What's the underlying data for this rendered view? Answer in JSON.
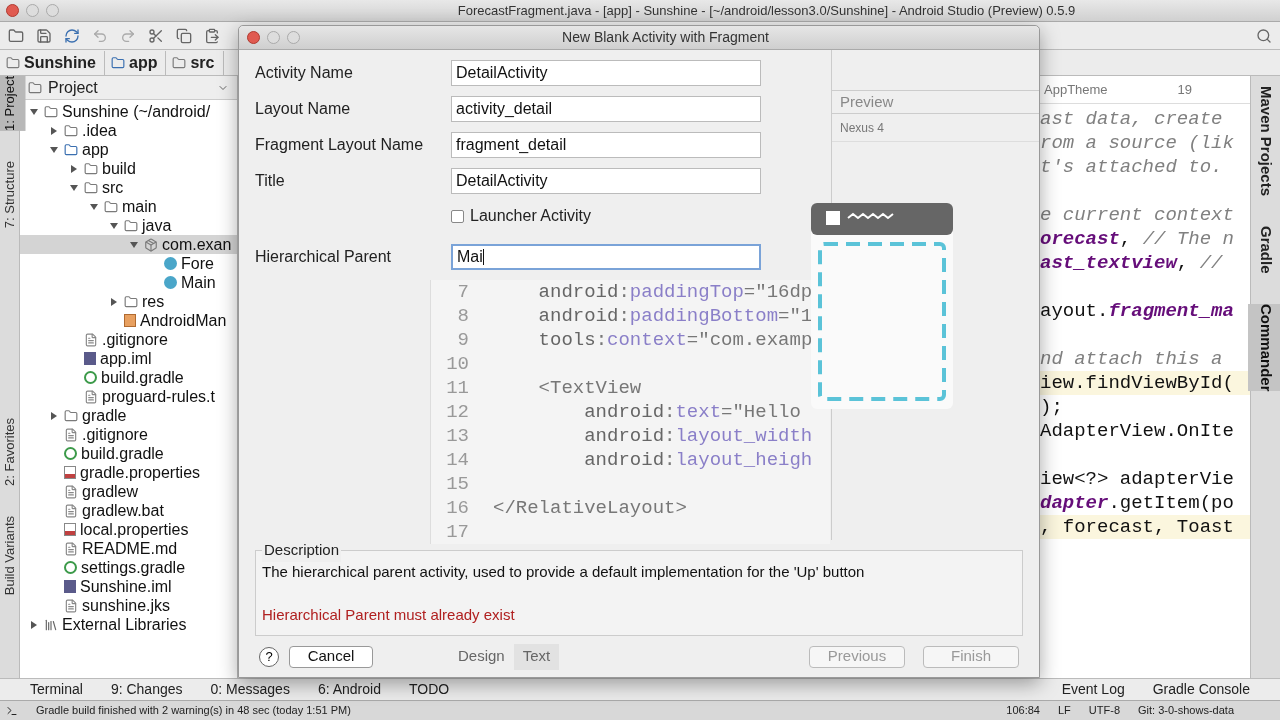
{
  "window": {
    "title": "ForecastFragment.java - [app] - Sunshine - [~/android/lesson3.0/Sunshine] - Android Studio (Preview) 0.5.9"
  },
  "breadcrumb": [
    {
      "label": "Sunshine",
      "kind": "project"
    },
    {
      "label": "app",
      "kind": "module"
    },
    {
      "label": "src",
      "kind": "folder"
    }
  ],
  "left_tool_tabs": [
    {
      "label": "1: Project",
      "selected": true
    },
    {
      "label": "7: Structure",
      "selected": false
    },
    {
      "label": "2: Favorites",
      "selected": false
    },
    {
      "label": "Build Variants",
      "selected": false
    }
  ],
  "project_panel": {
    "title": "Project",
    "tree": [
      {
        "label": "Sunshine (~/android/",
        "kind": "folder",
        "expanded": true,
        "selected": false,
        "children": [
          {
            "label": ".idea",
            "kind": "folder",
            "expanded": false,
            "selected": false
          },
          {
            "label": "app",
            "kind": "module",
            "expanded": true,
            "selected": false,
            "children": [
              {
                "label": "build",
                "kind": "folder",
                "expanded": false,
                "selected": false
              },
              {
                "label": "src",
                "kind": "folder",
                "expanded": true,
                "selected": false,
                "children": [
                  {
                    "label": "main",
                    "kind": "folder",
                    "expanded": true,
                    "selected": false,
                    "children": [
                      {
                        "label": "java",
                        "kind": "folder",
                        "expanded": true,
                        "selected": false,
                        "children": [
                          {
                            "label": "com.exan",
                            "kind": "package",
                            "expanded": true,
                            "selected": true,
                            "children": [
                              {
                                "label": "Fore",
                                "kind": "class",
                                "selected": false
                              },
                              {
                                "label": "Main",
                                "kind": "class",
                                "selected": false
                              }
                            ]
                          }
                        ]
                      },
                      {
                        "label": "res",
                        "kind": "folder",
                        "expanded": false,
                        "selected": false
                      },
                      {
                        "label": "AndroidMan",
                        "kind": "xml",
                        "selected": false
                      }
                    ]
                  }
                ]
              },
              {
                "label": ".gitignore",
                "kind": "file",
                "selected": false
              },
              {
                "label": "app.iml",
                "kind": "iml",
                "selected": false
              },
              {
                "label": "build.gradle",
                "kind": "gradle",
                "selected": false
              },
              {
                "label": "proguard-rules.t",
                "kind": "file",
                "selected": false
              }
            ]
          },
          {
            "label": "gradle",
            "kind": "folder",
            "expanded": false,
            "selected": false
          },
          {
            "label": ".gitignore",
            "kind": "file",
            "selected": false
          },
          {
            "label": "build.gradle",
            "kind": "gradle",
            "selected": false
          },
          {
            "label": "gradle.properties",
            "kind": "props",
            "selected": false
          },
          {
            "label": "gradlew",
            "kind": "file",
            "selected": false
          },
          {
            "label": "gradlew.bat",
            "kind": "file",
            "selected": false
          },
          {
            "label": "local.properties",
            "kind": "props",
            "selected": false
          },
          {
            "label": "README.md",
            "kind": "file",
            "selected": false
          },
          {
            "label": "settings.gradle",
            "kind": "gradle",
            "selected": false
          },
          {
            "label": "Sunshine.iml",
            "kind": "iml",
            "selected": false
          },
          {
            "label": "sunshine.jks",
            "kind": "file",
            "selected": false
          }
        ]
      },
      {
        "label": "External Libraries",
        "kind": "library",
        "expanded": false,
        "selected": false
      }
    ]
  },
  "dialog": {
    "title": "New Blank Activity with Fragment",
    "fields": [
      {
        "kind": "text",
        "label": "Activity Name",
        "value": "DetailActivity",
        "focused": false
      },
      {
        "kind": "text",
        "label": "Layout Name",
        "value": "activity_detail",
        "focused": false
      },
      {
        "kind": "text",
        "label": "Fragment Layout Name",
        "value": "fragment_detail",
        "focused": false
      },
      {
        "kind": "text",
        "label": "Title",
        "value": "DetailActivity",
        "focused": false
      },
      {
        "kind": "checkbox",
        "label": "Launcher Activity",
        "checked": false
      },
      {
        "kind": "text",
        "label": "Hierarchical Parent",
        "value": "Mai",
        "focused": true
      }
    ],
    "code_lines": [
      {
        "n": "7",
        "tokens": [
          {
            "text": "    android",
            "kind": "ns"
          },
          {
            "text": ":",
            "kind": "plain"
          },
          {
            "text": "paddingTop",
            "kind": "attr"
          },
          {
            "text": "=\"16dp",
            "kind": "val"
          }
        ]
      },
      {
        "n": "8",
        "tokens": [
          {
            "text": "    android",
            "kind": "ns"
          },
          {
            "text": ":",
            "kind": "plain"
          },
          {
            "text": "paddingBottom",
            "kind": "attr"
          },
          {
            "text": "=\"1",
            "kind": "val"
          }
        ]
      },
      {
        "n": "9",
        "tokens": [
          {
            "text": "    tools",
            "kind": "ns"
          },
          {
            "text": ":",
            "kind": "plain"
          },
          {
            "text": "context",
            "kind": "attr"
          },
          {
            "text": "=\"com.examp",
            "kind": "val"
          }
        ]
      },
      {
        "n": "10"
      },
      {
        "n": "11",
        "tokens": [
          {
            "text": "    <TextView",
            "kind": "tag"
          }
        ]
      },
      {
        "n": "12",
        "tokens": [
          {
            "text": "        android",
            "kind": "ns"
          },
          {
            "text": ":",
            "kind": "plain"
          },
          {
            "text": "text",
            "kind": "attr"
          },
          {
            "text": "=\"Hello",
            "kind": "val"
          }
        ]
      },
      {
        "n": "13",
        "tokens": [
          {
            "text": "        android",
            "kind": "ns"
          },
          {
            "text": ":",
            "kind": "plain"
          },
          {
            "text": "layout_width",
            "kind": "attr"
          }
        ]
      },
      {
        "n": "14",
        "tokens": [
          {
            "text": "        android",
            "kind": "ns"
          },
          {
            "text": ":",
            "kind": "plain"
          },
          {
            "text": "layout_heigh",
            "kind": "attr"
          }
        ]
      },
      {
        "n": "15"
      },
      {
        "n": "16",
        "tokens": [
          {
            "text": "</RelativeLayout>",
            "kind": "tag"
          }
        ]
      },
      {
        "n": "17"
      }
    ],
    "preview": {
      "title": "Preview",
      "device": "Nexus 4"
    },
    "description": {
      "title": "Description",
      "text": "The hierarchical parent activity, used to provide a default implementation for the 'Up' button",
      "error": "Hierarchical Parent must already exist"
    },
    "help": "?",
    "editor_tabs": [
      {
        "label": "Design",
        "selected": false
      },
      {
        "label": "Text",
        "selected": true
      }
    ],
    "buttons": [
      {
        "label": "Cancel",
        "enabled": true
      },
      {
        "label": "Previous",
        "enabled": false
      },
      {
        "label": "Finish",
        "enabled": false
      }
    ]
  },
  "editor_toolbar": {
    "theme": "AppTheme",
    "api": "19"
  },
  "editor_blocks": [
    [
      {
        "highlighted": false,
        "tokens": [
          {
            "text": "ast data, create",
            "kind": "comment"
          }
        ]
      },
      {
        "highlighted": false,
        "tokens": [
          {
            "text": "rom a source (lik",
            "kind": "comment"
          }
        ]
      },
      {
        "highlighted": false,
        "tokens": [
          {
            "text": "t's attached to.",
            "kind": "comment"
          }
        ]
      }
    ],
    [
      {
        "highlighted": false,
        "tokens": [
          {
            "text": "e current context",
            "kind": "comment"
          }
        ]
      },
      {
        "highlighted": false,
        "tokens": [
          {
            "text": "orecast",
            "kind": "field"
          },
          {
            "text": ", ",
            "kind": "plain"
          },
          {
            "text": "// The n",
            "kind": "comment"
          }
        ]
      },
      {
        "highlighted": false,
        "tokens": [
          {
            "text": "ast_textview",
            "kind": "field"
          },
          {
            "text": ", ",
            "kind": "plain"
          },
          {
            "text": "//",
            "kind": "comment"
          }
        ]
      }
    ],
    [
      {
        "highlighted": false,
        "tokens": [
          {
            "text": "ayout.",
            "kind": "plain"
          },
          {
            "text": "fragment_ma",
            "kind": "field"
          }
        ]
      }
    ],
    [
      {
        "highlighted": false,
        "tokens": [
          {
            "text": "nd attach this a",
            "kind": "comment"
          }
        ]
      },
      {
        "highlighted": true,
        "tokens": [
          {
            "text": "iew.findViewById(",
            "kind": "plain"
          }
        ]
      },
      {
        "highlighted": false,
        "tokens": [
          {
            "text": ");",
            "kind": "plain"
          }
        ]
      },
      {
        "highlighted": false,
        "tokens": [
          {
            "text": "AdapterView.OnIte",
            "kind": "plain"
          }
        ]
      }
    ],
    [
      {
        "highlighted": false,
        "tokens": [
          {
            "text": "iew<?> adapterVie",
            "kind": "plain"
          }
        ]
      },
      {
        "highlighted": false,
        "tokens": [
          {
            "text": "dapter",
            "kind": "field"
          },
          {
            "text": ".getItem(po",
            "kind": "plain"
          }
        ]
      },
      {
        "highlighted": true,
        "tokens": [
          {
            "text": ", forecast, Toast",
            "kind": "plain"
          }
        ]
      }
    ]
  ],
  "right_tool_tabs": [
    {
      "label": "Maven Projects",
      "selected": false
    },
    {
      "label": "Gradle",
      "selected": false
    },
    {
      "label": "Commander",
      "selected": true
    }
  ],
  "bottom_tools": [
    {
      "label": "Terminal"
    },
    {
      "label": "9: Changes"
    },
    {
      "label": "0: Messages"
    },
    {
      "label": "6: Android"
    },
    {
      "label": "TODO"
    }
  ],
  "bottom_tools_right": [
    {
      "label": "Event Log"
    },
    {
      "label": "Gradle Console"
    }
  ],
  "status_bar": {
    "message": "Gradle build finished with 2 warning(s) in 48 sec (today 1:51 PM)",
    "position": "106:84",
    "line_sep": "LF",
    "encoding": "UTF-8",
    "vcs": "Git: 3-0-shows-data"
  }
}
